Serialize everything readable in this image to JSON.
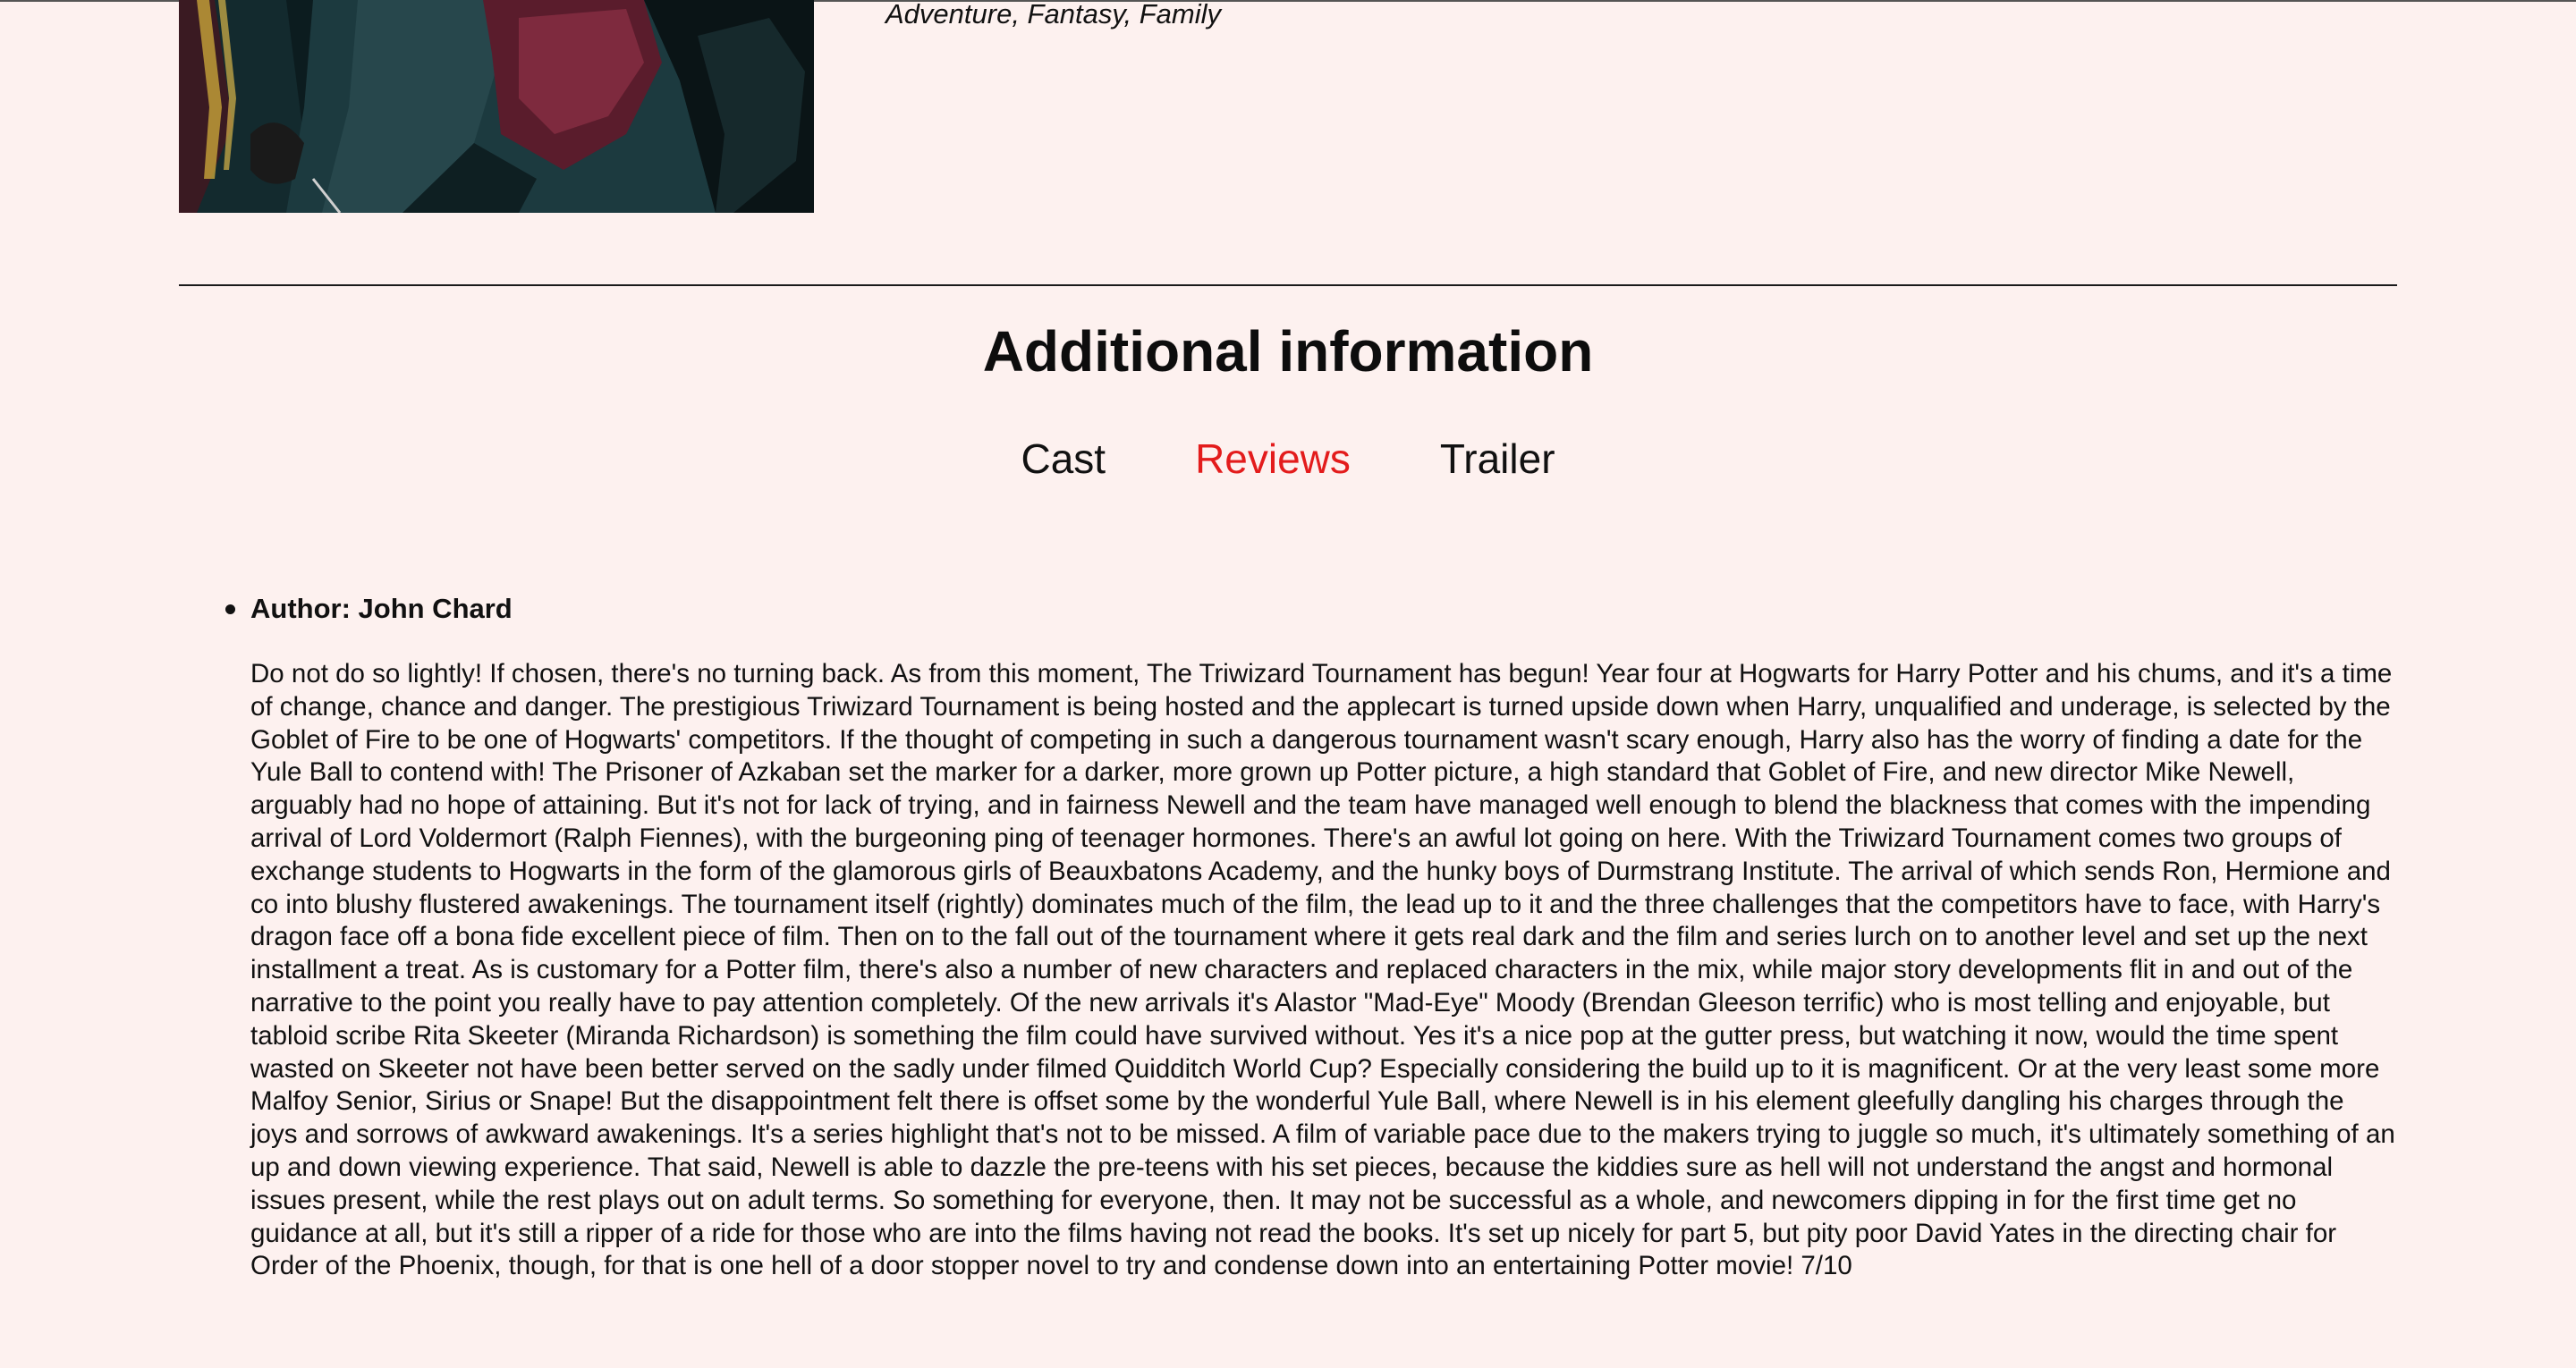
{
  "movie": {
    "genres": "Adventure, Fantasy, Family"
  },
  "additional_info": {
    "title": "Additional information",
    "tabs": [
      {
        "label": "Cast",
        "active": false
      },
      {
        "label": "Reviews",
        "active": true
      },
      {
        "label": "Trailer",
        "active": false
      }
    ]
  },
  "reviews": [
    {
      "author_line": "Author: John Chard",
      "content": "Do not do so lightly! If chosen, there's no turning back. As from this moment, The Triwizard Tournament has begun! Year four at Hogwarts for Harry Potter and his chums, and it's a time of change, chance and danger. The prestigious Triwizard Tournament is being hosted and the applecart is turned upside down when Harry, unqualified and underage, is selected by the Goblet of Fire to be one of Hogwarts' competitors. If the thought of competing in such a dangerous tournament wasn't scary enough, Harry also has the worry of finding a date for the Yule Ball to contend with! The Prisoner of Azkaban set the marker for a darker, more grown up Potter picture, a high standard that Goblet of Fire, and new director Mike Newell, arguably had no hope of attaining. But it's not for lack of trying, and in fairness Newell and the team have managed well enough to blend the blackness that comes with the impending arrival of Lord Voldermort (Ralph Fiennes), with the burgeoning ping of teenager hormones. There's an awful lot going on here. With the Triwizard Tournament comes two groups of exchange students to Hogwarts in the form of the glamorous girls of Beauxbatons Academy, and the hunky boys of Durmstrang Institute. The arrival of which sends Ron, Hermione and co into blushy flustered awakenings. The tournament itself (rightly) dominates much of the film, the lead up to it and the three challenges that the competitors have to face, with Harry's dragon face off a bona fide excellent piece of film. Then on to the fall out of the tournament where it gets real dark and the film and series lurch on to another level and set up the next installment a treat. As is customary for a Potter film, there's also a number of new characters and replaced characters in the mix, while major story developments flit in and out of the narrative to the point you really have to pay attention completely. Of the new arrivals it's Alastor \"Mad-Eye\" Moody (Brendan Gleeson terrific) who is most telling and enjoyable, but tabloid scribe Rita Skeeter (Miranda Richardson) is something the film could have survived without. Yes it's a nice pop at the gutter press, but watching it now, would the time spent wasted on Skeeter not have been better served on the sadly under filmed Quidditch World Cup? Especially considering the build up to it is magnificent. Or at the very least some more Malfoy Senior, Sirius or Snape! But the disappointment felt there is offset some by the wonderful Yule Ball, where Newell is in his element gleefully dangling his charges through the joys and sorrows of awkward awakenings. It's a series highlight that's not to be missed. A film of variable pace due to the makers trying to juggle so much, it's ultimately something of an up and down viewing experience. That said, Newell is able to dazzle the pre-teens with his set pieces, because the kiddies sure as hell will not understand the angst and hormonal issues present, while the rest plays out on adult terms. So something for everyone, then. It may not be successful as a whole, and newcomers dipping in for the first time get no guidance at all, but it's still a ripper of a ride for those who are into the films having not read the books. It's set up nicely for part 5, but pity poor David Yates in the directing chair for Order of the Phoenix, though, for that is one hell of a door stopper novel to try and condense down into an entertaining Potter movie! 7/10"
    }
  ],
  "colors": {
    "background": "#fdf1ef",
    "active_tab": "#e31c1c",
    "text": "#111111"
  }
}
